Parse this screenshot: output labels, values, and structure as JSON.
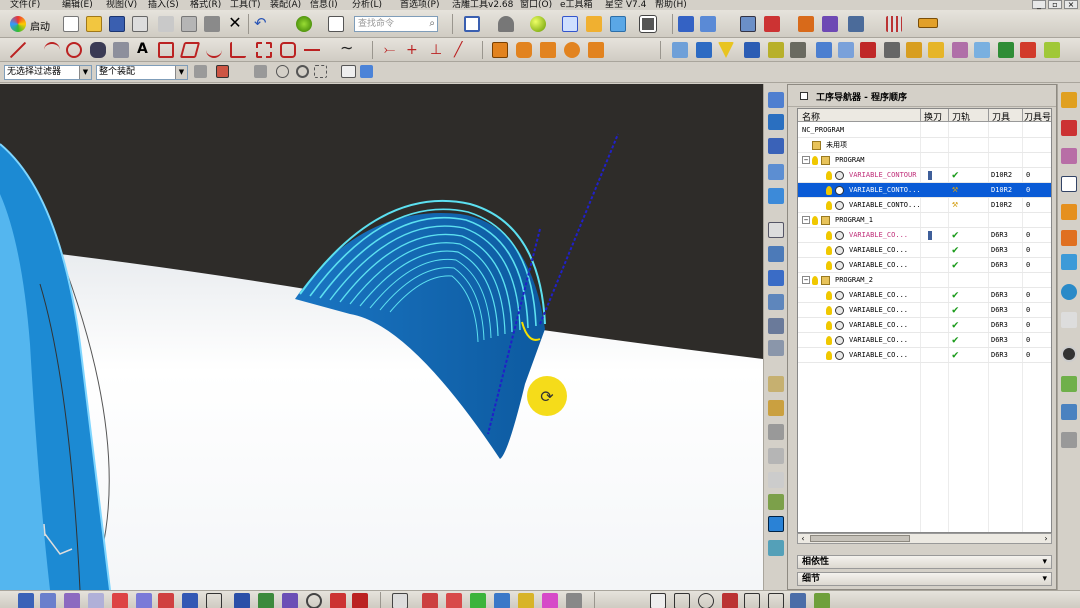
{
  "menubar": {
    "items": [
      "文件(F)",
      "编辑(E)",
      "视图(V)",
      "插入(S)",
      "格式(R)",
      "工具(T)",
      "装配(A)",
      "信息(I)",
      "分析(L)",
      "首选项(P)",
      "活雕工具v2.68",
      "窗口(O)",
      "e工具箱",
      "星空 V7.4",
      "帮助(H)"
    ]
  },
  "toolbar": {
    "start_label": "启动",
    "search_placeholder": "查找命令",
    "filter_label": "无选择过滤器",
    "assembly_label": "整个装配"
  },
  "navigator": {
    "title": "工序导航器 - 程序顺序",
    "columns": [
      "名称",
      "换刀",
      "刀轨",
      "刀具",
      "刀具号"
    ],
    "rows": [
      {
        "name": "NC_PROGRAM",
        "level": 0,
        "kind": "root",
        "toolchange": "",
        "path": "",
        "tool": "",
        "num": ""
      },
      {
        "name": "未用项",
        "level": 1,
        "kind": "folder",
        "toolchange": "",
        "path": "",
        "tool": "",
        "num": ""
      },
      {
        "name": "PROGRAM",
        "level": 1,
        "kind": "program",
        "toolchange": "",
        "path": "",
        "tool": "",
        "num": ""
      },
      {
        "name": "VARIABLE_CONTOUR",
        "level": 2,
        "kind": "op",
        "toolchange": "tool",
        "path": "check",
        "tool": "D10R2",
        "num": "0",
        "style": "pink"
      },
      {
        "name": "VARIABLE_CONTO...",
        "level": 2,
        "kind": "op",
        "toolchange": "",
        "path": "wrench",
        "tool": "D10R2",
        "num": "0",
        "style": "selected"
      },
      {
        "name": "VARIABLE_CONTO...",
        "level": 2,
        "kind": "op",
        "toolchange": "",
        "path": "wrench",
        "tool": "D10R2",
        "num": "0",
        "style": "normal"
      },
      {
        "name": "PROGRAM_1",
        "level": 1,
        "kind": "program",
        "toolchange": "",
        "path": "",
        "tool": "",
        "num": ""
      },
      {
        "name": "VARIABLE_CO...",
        "level": 2,
        "kind": "op",
        "toolchange": "tool",
        "path": "check",
        "tool": "D6R3",
        "num": "0",
        "style": "pink"
      },
      {
        "name": "VARIABLE_CO...",
        "level": 2,
        "kind": "op",
        "toolchange": "",
        "path": "check",
        "tool": "D6R3",
        "num": "0",
        "style": "normal"
      },
      {
        "name": "VARIABLE_CO...",
        "level": 2,
        "kind": "op",
        "toolchange": "",
        "path": "check",
        "tool": "D6R3",
        "num": "0",
        "style": "normal"
      },
      {
        "name": "PROGRAM_2",
        "level": 1,
        "kind": "program",
        "toolchange": "",
        "path": "",
        "tool": "",
        "num": ""
      },
      {
        "name": "VARIABLE_CO...",
        "level": 2,
        "kind": "op",
        "toolchange": "",
        "path": "check",
        "tool": "D6R3",
        "num": "0",
        "style": "normal"
      },
      {
        "name": "VARIABLE_CO...",
        "level": 2,
        "kind": "op",
        "toolchange": "",
        "path": "check",
        "tool": "D6R3",
        "num": "0",
        "style": "normal"
      },
      {
        "name": "VARIABLE_CO...",
        "level": 2,
        "kind": "op",
        "toolchange": "",
        "path": "check",
        "tool": "D6R3",
        "num": "0",
        "style": "normal"
      },
      {
        "name": "VARIABLE_CO...",
        "level": 2,
        "kind": "op",
        "toolchange": "",
        "path": "check",
        "tool": "D6R3",
        "num": "0",
        "style": "normal"
      },
      {
        "name": "VARIABLE_CO...",
        "level": 2,
        "kind": "op",
        "toolchange": "",
        "path": "check",
        "tool": "D6R3",
        "num": "0",
        "style": "normal"
      }
    ],
    "dependency_label": "相依性",
    "details_label": "细节"
  },
  "colors": {
    "selection": "#0a5bd6",
    "pink_text": "#c0307a",
    "check": "#1a9a1a",
    "toolpath_blue": "#1d8fd6",
    "viewport_bg": "#2e2c29"
  }
}
